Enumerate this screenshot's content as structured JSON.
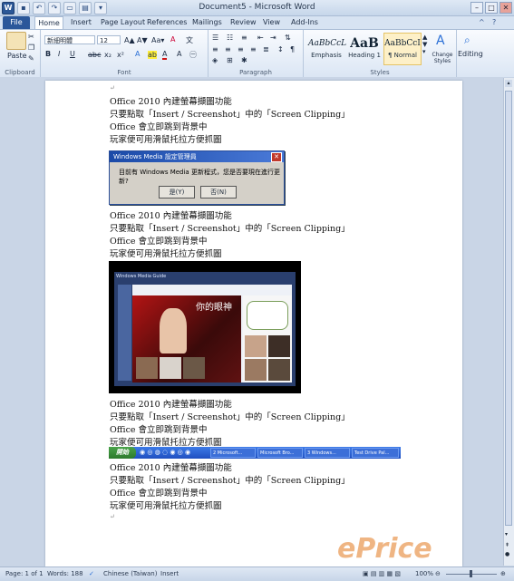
{
  "window": {
    "title": "Document5 - Microsoft Word"
  },
  "tabs": [
    "File",
    "Home",
    "Insert",
    "Page Layout",
    "References",
    "Mailings",
    "Review",
    "View",
    "Add-Ins"
  ],
  "ribbon": {
    "clipboard": {
      "label": "Clipboard",
      "paste": "Paste"
    },
    "font": {
      "label": "Font",
      "family": "新細明體",
      "size": "12",
      "bold": "B",
      "italic": "I",
      "underline": "U",
      "strike": "abc",
      "sub": "x₂",
      "sup": "x²",
      "grow": "A▲",
      "shrink": "A▼",
      "case": "Aa▾",
      "clear": "A",
      "color": "A",
      "highlight": "ab"
    },
    "paragraph": {
      "label": "Paragraph"
    },
    "styles": {
      "label": "Styles",
      "items": [
        {
          "sample": "AaBbCcL",
          "name": "Emphasis"
        },
        {
          "sample": "AaB",
          "name": "Heading 1"
        },
        {
          "sample": "AaBbCcI",
          "name": "¶ Normal"
        }
      ],
      "change": "Change Styles"
    },
    "editing": {
      "label": "Editing"
    }
  },
  "doc": {
    "paragraph_mark": "↵",
    "block": [
      "Office 2010 內建螢幕擷圖功能",
      "只要點取「Insert / Screenshot」中的「Screen Clipping」",
      "Office 會立即跳到背景中",
      "玩家便可用滑鼠托拉方便抓圖"
    ]
  },
  "dialog": {
    "title": "Windows Media 設定管理員",
    "close": "✕",
    "message": "目前有 Windows Media 更新程式，您是否要現在進行更新?",
    "yes": "是(Y)",
    "no": "否(N)"
  },
  "wmp": {
    "tab": "Windows Media Guide",
    "heading": "你的眼神"
  },
  "taskbar": {
    "start": "開始",
    "items": [
      "2 Microsoft...",
      "Microsoft Bro...",
      "3 Windows...",
      "Test Drive Pal..."
    ]
  },
  "status": {
    "page": "Page: 1 of 1",
    "words": "Words: 188",
    "language": "Chinese (Taiwan)",
    "mode": "Insert",
    "zoom": "100%"
  },
  "watermark": "ePrice"
}
